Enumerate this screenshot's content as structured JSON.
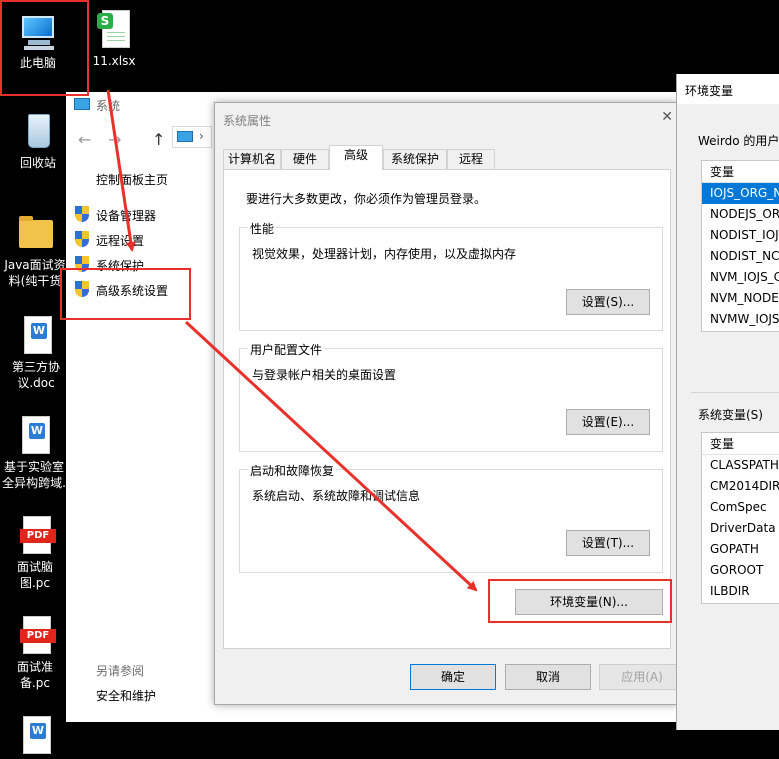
{
  "desktop": {
    "icons": [
      {
        "label": "此电脑",
        "icon": "computer-icon"
      },
      {
        "label": "11.xlsx",
        "icon": "spreadsheet-icon"
      },
      {
        "label": "回收站",
        "icon": "recycle-bin-icon"
      },
      {
        "label": "Java面试资料(纯干货",
        "icon": "folder-icon"
      },
      {
        "label": "第三方协议.doc",
        "icon": "word-icon"
      },
      {
        "label": "基于实验室全异构跨域.",
        "icon": "word-icon"
      },
      {
        "label": "面试脑图.pc",
        "icon": "pdf-icon"
      },
      {
        "label": "面试准备.pc",
        "icon": "pdf-icon"
      }
    ],
    "pdf_tag": "PDF"
  },
  "explorer": {
    "title": "系统",
    "control_panel_home": "控制面板主页",
    "links": [
      {
        "label": "设备管理器"
      },
      {
        "label": "远程设置"
      },
      {
        "label": "系统保护"
      },
      {
        "label": "高级系统设置"
      }
    ],
    "see_also": "另请参阅",
    "security_maintenance": "安全和维护"
  },
  "system_properties": {
    "title": "系统属性",
    "tabs": [
      "计算机名",
      "硬件",
      "高级",
      "系统保护",
      "远程"
    ],
    "active_tab": "高级",
    "admin_note": "要进行大多数更改，你必须作为管理员登录。",
    "performance": {
      "legend": "性能",
      "desc": "视觉效果，处理器计划，内存使用，以及虚拟内存",
      "button": "设置(S)..."
    },
    "user_profiles": {
      "legend": "用户配置文件",
      "desc": "与登录帐户相关的桌面设置",
      "button": "设置(E)..."
    },
    "startup_recovery": {
      "legend": "启动和故障恢复",
      "desc": "系统启动、系统故障和调试信息",
      "button": "设置(T)..."
    },
    "env_button": "环境变量(N)...",
    "ok": "确定",
    "cancel": "取消",
    "apply": "应用(A)"
  },
  "env_vars": {
    "title": "环境变量",
    "user_label": "Weirdo 的用户",
    "var_header": "变量",
    "user_vars": [
      "IOJS_ORG_N",
      "NODEJS_OR",
      "NODIST_IOJ",
      "NODIST_NC",
      "NVM_IOJS_C",
      "NVM_NODE",
      "NVMW_IOJS"
    ],
    "system_label": "系统变量(S)",
    "system_vars": [
      "CLASSPATH",
      "CM2014DIR",
      "ComSpec",
      "DriverData",
      "GOPATH",
      "GOROOT",
      "ILBDIR"
    ]
  },
  "colors": {
    "annotation": "#e8312a",
    "selection": "#0078d7"
  }
}
